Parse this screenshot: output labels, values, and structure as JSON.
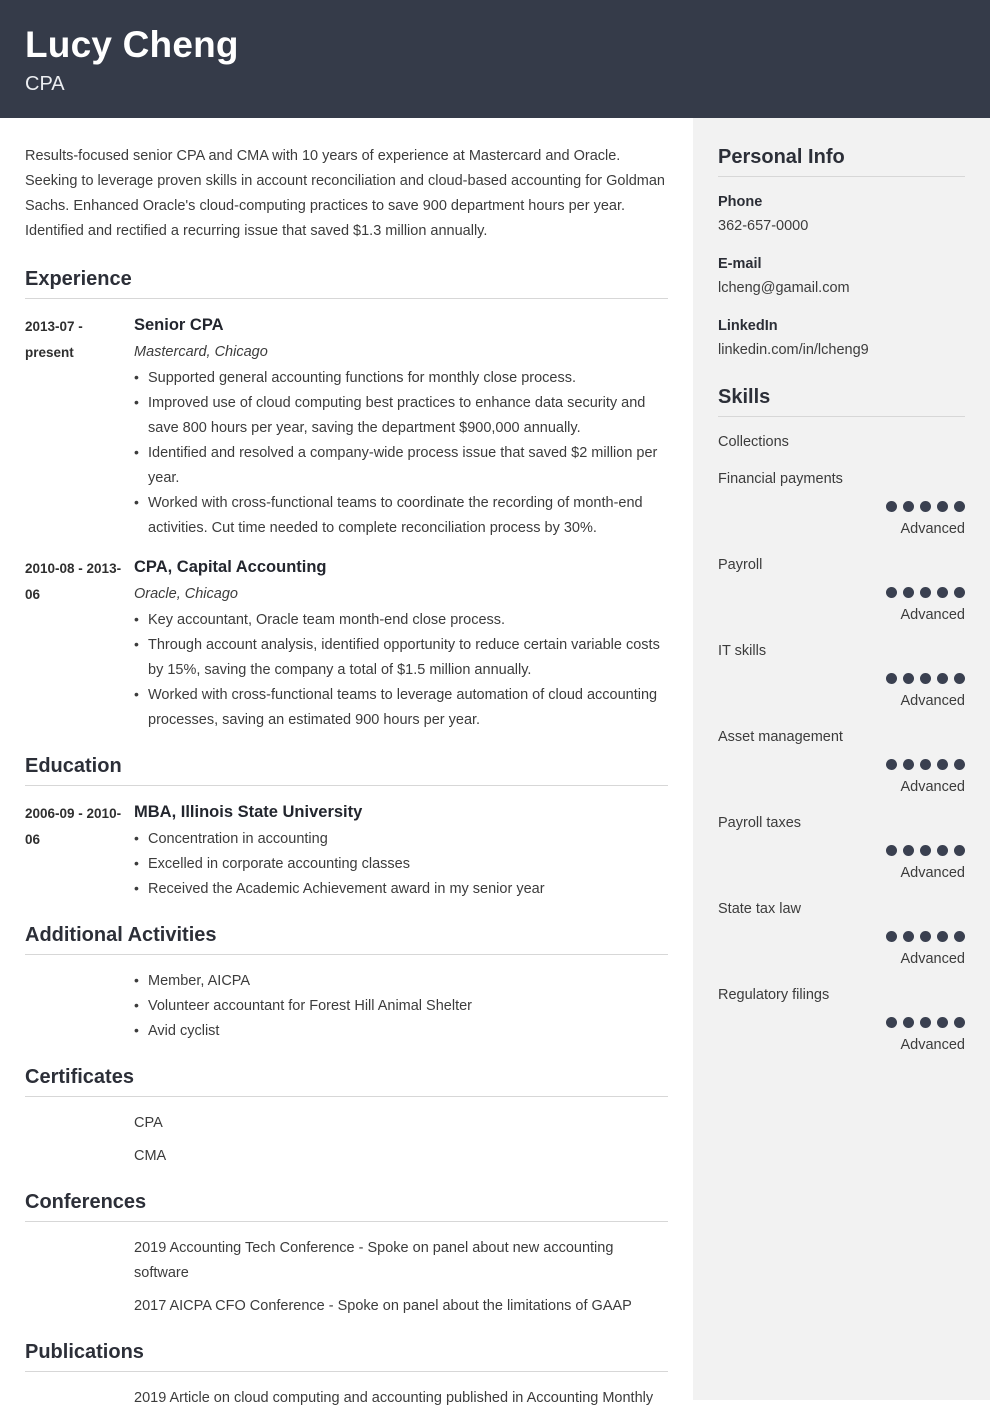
{
  "header": {
    "name": "Lucy Cheng",
    "role": "CPA",
    "background_color": "#353b49"
  },
  "summary": {
    "text": "Results-focused senior CPA and CMA with 10 years of experience at Mastercard and Oracle. Seeking to leverage proven skills in account reconciliation and cloud-based accounting for Goldman Sachs. Enhanced Oracle's cloud-computing practices to save 900 department hours per year. Identified and rectified a recurring issue that saved $1.3 million annually."
  },
  "sections": {
    "experience": {
      "title": "Experience",
      "entries": [
        {
          "dates": "2013-07 - present",
          "title": "Senior CPA",
          "subtitle": "Mastercard, Chicago",
          "bullets": [
            "Supported general accounting functions for monthly close process.",
            "Improved use of cloud computing best practices to enhance data security and save 800 hours per year, saving the department $900,000 annually.",
            "Identified and resolved a company-wide process issue that saved $2 million per year.",
            "Worked with cross-functional teams to coordinate the recording of month-end activities. Cut time needed to complete reconciliation process by 30%."
          ]
        },
        {
          "dates": "2010-08 - 2013-06",
          "title": "CPA, Capital Accounting",
          "subtitle": "Oracle, Chicago",
          "bullets": [
            "Key accountant, Oracle team month-end close process.",
            "Through account analysis, identified opportunity to reduce certain variable costs by 15%, saving the company a total of $1.5 million annually.",
            "Worked with cross-functional teams to leverage automation of cloud accounting processes, saving an estimated 900 hours per year."
          ]
        }
      ]
    },
    "education": {
      "title": "Education",
      "entries": [
        {
          "dates": "2006-09 - 2010-06",
          "title": "MBA, Illinois State University",
          "subtitle": "",
          "bullets": [
            "Concentration in accounting",
            "Excelled in corporate accounting classes",
            "Received the Academic Achievement award in my senior year"
          ]
        }
      ]
    },
    "additional_activities": {
      "title": "Additional Activities",
      "bullets": [
        "Member, AICPA",
        "Volunteer accountant for Forest Hill Animal Shelter",
        "Avid cyclist"
      ]
    },
    "certificates": {
      "title": "Certificates",
      "items": [
        "CPA",
        "CMA"
      ]
    },
    "conferences": {
      "title": "Conferences",
      "items": [
        "2019 Accounting Tech Conference - Spoke on panel about new accounting software",
        "2017 AICPA CFO Conference - Spoke on panel about the limitations of GAAP"
      ]
    },
    "publications": {
      "title": "Publications",
      "items": [
        "2019 Article on cloud computing and accounting published in Accounting Monthly"
      ]
    }
  },
  "sidebar": {
    "personal_info": {
      "title": "Personal Info",
      "fields": [
        {
          "label": "Phone",
          "value": "362-657-0000"
        },
        {
          "label": "E-mail",
          "value": "lcheng@gamail.com"
        },
        {
          "label": "LinkedIn",
          "value": "linkedin.com/in/lcheng9"
        }
      ]
    },
    "skills": {
      "title": "Skills",
      "max_rating": 5,
      "dot_color": "#3a4050",
      "items": [
        {
          "name": "Collections",
          "rating": null,
          "level": ""
        },
        {
          "name": "Financial payments",
          "rating": 5,
          "level": "Advanced"
        },
        {
          "name": "Payroll",
          "rating": 5,
          "level": "Advanced"
        },
        {
          "name": "IT skills",
          "rating": 5,
          "level": "Advanced"
        },
        {
          "name": "Asset management",
          "rating": 5,
          "level": "Advanced"
        },
        {
          "name": "Payroll taxes",
          "rating": 5,
          "level": "Advanced"
        },
        {
          "name": "State tax law",
          "rating": 5,
          "level": "Advanced"
        },
        {
          "name": "Regulatory filings",
          "rating": 5,
          "level": "Advanced"
        }
      ]
    }
  }
}
